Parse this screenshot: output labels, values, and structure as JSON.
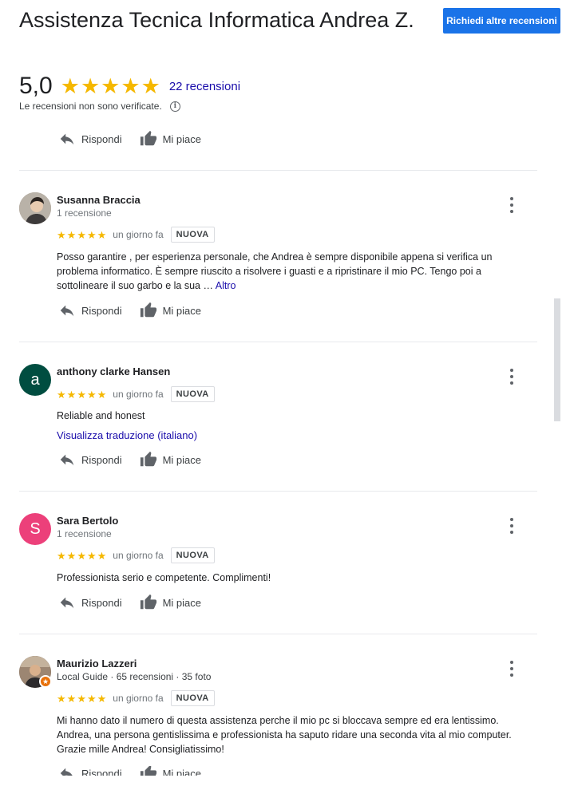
{
  "header": {
    "title": "Assistenza Tecnica Informatica Andrea Z.",
    "more_reviews_button": "Richiedi altre recensioni",
    "rating_value": "5,0",
    "star_rating": 5,
    "reviews_count_link": "22 recensioni",
    "unverified_notice": "Le recensioni non sono verificate.",
    "info_icon": "info-icon"
  },
  "actions": {
    "reply_label": "Rispondi",
    "like_label": "Mi piace",
    "reply_icon": "reply-icon",
    "like_icon": "thumbs-up-icon"
  },
  "reviews": [
    {
      "name": "Susanna Braccia",
      "meta": "1 recensione",
      "stars": 5,
      "date": "un giorno fa",
      "badge": "NUOVA",
      "text": "Posso garantire , per esperienza personale,  che Andrea è sempre disponibile appena si verifica un problema informatico.  È  sempre riuscito a risolvere i guasti e a ripristinare il mio PC. Tengo poi a sottolineare il suo garbo e la sua … ",
      "more_link": "Altro",
      "avatar_type": "photo"
    },
    {
      "name": "anthony clarke Hansen",
      "stars": 5,
      "date": "un giorno fa",
      "badge": "NUOVA",
      "text": "Reliable and honest",
      "translate_link": "Visualizza traduzione (italiano)",
      "avatar_letter": "a",
      "avatar_color": "#004d40"
    },
    {
      "name": "Sara Bertolo",
      "meta": "1 recensione",
      "stars": 5,
      "date": "un giorno fa",
      "badge": "NUOVA",
      "text": "Professionista serio e competente. Complimenti!",
      "avatar_letter": "S",
      "avatar_color": "#ec407a"
    },
    {
      "name": "Maurizio Lazzeri",
      "meta": "Local Guide · 65 recensioni · 35 foto",
      "stars": 5,
      "date": "un giorno fa",
      "badge": "NUOVA",
      "text": "Mi hanno dato il numero di questa assistenza perche il mio pc si bloccava sempre ed era lentissimo. Andrea, una persona gentislissima e professionista ha saputo ridare una seconda vita al mio computer. Grazie mille Andrea! Consigliatissimo!",
      "avatar_type": "photo",
      "local_guide_badge_icon": "local-guide-star-icon"
    }
  ]
}
